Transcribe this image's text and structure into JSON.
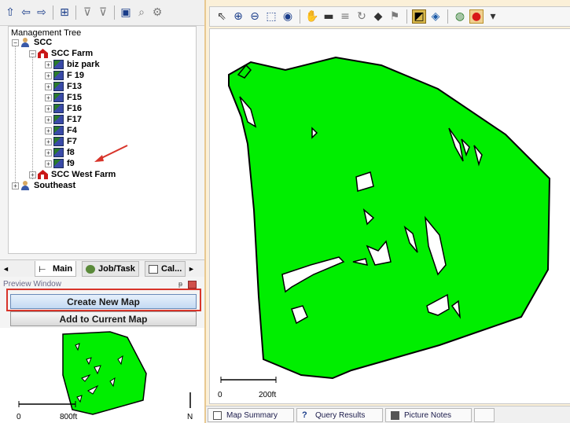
{
  "left_toolbar": {
    "icons": [
      "up-arrow-icon",
      "back-arrow-icon",
      "forward-arrow-icon",
      "tree-view-icon",
      "filter-icon",
      "clear-filter-icon",
      "properties-icon",
      "find-icon",
      "settings-icon"
    ]
  },
  "tree": {
    "title": "Management Tree",
    "nodes": [
      {
        "label": "SCC",
        "level": 0,
        "type": "grower",
        "expander": "−"
      },
      {
        "label": "SCC Farm",
        "level": 1,
        "type": "farm",
        "expander": "−"
      },
      {
        "label": "biz park",
        "level": 2,
        "type": "field",
        "expander": "+"
      },
      {
        "label": "F 19",
        "level": 2,
        "type": "field",
        "expander": "+"
      },
      {
        "label": "F13",
        "level": 2,
        "type": "field",
        "expander": "+"
      },
      {
        "label": "F15",
        "level": 2,
        "type": "field",
        "expander": "+"
      },
      {
        "label": "F16",
        "level": 2,
        "type": "field",
        "expander": "+"
      },
      {
        "label": "F17",
        "level": 2,
        "type": "field",
        "expander": "+"
      },
      {
        "label": "F4",
        "level": 2,
        "type": "field",
        "expander": "+"
      },
      {
        "label": "F7",
        "level": 2,
        "type": "field",
        "expander": "+"
      },
      {
        "label": "f8",
        "level": 2,
        "type": "field",
        "expander": "+"
      },
      {
        "label": "f9",
        "level": 2,
        "type": "field",
        "expander": "+"
      },
      {
        "label": "SCC West Farm",
        "level": 1,
        "type": "farm",
        "expander": "+"
      },
      {
        "label": "Southeast",
        "level": 0,
        "type": "grower",
        "expander": "+"
      }
    ]
  },
  "tabs": {
    "scroll_left": "◄",
    "main": "Main",
    "job_task": "Job/Task",
    "calendar": "Cal...",
    "scroll_right": "►"
  },
  "preview": {
    "title": "Preview Window",
    "pin": "ᵽ",
    "create_new_map": "Create New Map",
    "add_to_current_map": "Add to Current Map",
    "scale_left": "0",
    "scale_right": "800ft",
    "north": "N"
  },
  "map": {
    "scale_left": "0",
    "scale_right": "200ft",
    "field_color": "#00ee00",
    "toolbar_icons": [
      "select-arrow-icon",
      "zoom-in-icon",
      "zoom-out-icon",
      "zoom-box-icon",
      "zoom-extent-icon",
      "pan-hand-icon",
      "measure-icon",
      "label-icon",
      "rotate-icon",
      "layer-icon",
      "flag-icon",
      "color-ramp-icon",
      "layers-color-icon",
      "globe-icon",
      "record-icon",
      "more-icon"
    ]
  },
  "status_tabs": {
    "map_summary": "Map Summary",
    "query_results": "Query Results",
    "picture_notes": "Picture Notes"
  }
}
